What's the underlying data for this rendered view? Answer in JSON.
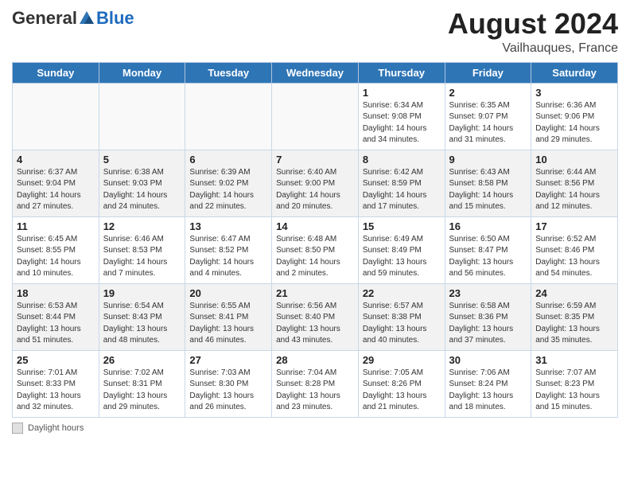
{
  "header": {
    "logo_general": "General",
    "logo_blue": "Blue",
    "title": "August 2024",
    "subtitle": "Vailhauques, France"
  },
  "footer": {
    "legend_label": "Daylight hours"
  },
  "days_of_week": [
    "Sunday",
    "Monday",
    "Tuesday",
    "Wednesday",
    "Thursday",
    "Friday",
    "Saturday"
  ],
  "weeks": [
    [
      {
        "num": "",
        "info": ""
      },
      {
        "num": "",
        "info": ""
      },
      {
        "num": "",
        "info": ""
      },
      {
        "num": "",
        "info": ""
      },
      {
        "num": "1",
        "info": "Sunrise: 6:34 AM\nSunset: 9:08 PM\nDaylight: 14 hours\nand 34 minutes."
      },
      {
        "num": "2",
        "info": "Sunrise: 6:35 AM\nSunset: 9:07 PM\nDaylight: 14 hours\nand 31 minutes."
      },
      {
        "num": "3",
        "info": "Sunrise: 6:36 AM\nSunset: 9:06 PM\nDaylight: 14 hours\nand 29 minutes."
      }
    ],
    [
      {
        "num": "4",
        "info": "Sunrise: 6:37 AM\nSunset: 9:04 PM\nDaylight: 14 hours\nand 27 minutes."
      },
      {
        "num": "5",
        "info": "Sunrise: 6:38 AM\nSunset: 9:03 PM\nDaylight: 14 hours\nand 24 minutes."
      },
      {
        "num": "6",
        "info": "Sunrise: 6:39 AM\nSunset: 9:02 PM\nDaylight: 14 hours\nand 22 minutes."
      },
      {
        "num": "7",
        "info": "Sunrise: 6:40 AM\nSunset: 9:00 PM\nDaylight: 14 hours\nand 20 minutes."
      },
      {
        "num": "8",
        "info": "Sunrise: 6:42 AM\nSunset: 8:59 PM\nDaylight: 14 hours\nand 17 minutes."
      },
      {
        "num": "9",
        "info": "Sunrise: 6:43 AM\nSunset: 8:58 PM\nDaylight: 14 hours\nand 15 minutes."
      },
      {
        "num": "10",
        "info": "Sunrise: 6:44 AM\nSunset: 8:56 PM\nDaylight: 14 hours\nand 12 minutes."
      }
    ],
    [
      {
        "num": "11",
        "info": "Sunrise: 6:45 AM\nSunset: 8:55 PM\nDaylight: 14 hours\nand 10 minutes."
      },
      {
        "num": "12",
        "info": "Sunrise: 6:46 AM\nSunset: 8:53 PM\nDaylight: 14 hours\nand 7 minutes."
      },
      {
        "num": "13",
        "info": "Sunrise: 6:47 AM\nSunset: 8:52 PM\nDaylight: 14 hours\nand 4 minutes."
      },
      {
        "num": "14",
        "info": "Sunrise: 6:48 AM\nSunset: 8:50 PM\nDaylight: 14 hours\nand 2 minutes."
      },
      {
        "num": "15",
        "info": "Sunrise: 6:49 AM\nSunset: 8:49 PM\nDaylight: 13 hours\nand 59 minutes."
      },
      {
        "num": "16",
        "info": "Sunrise: 6:50 AM\nSunset: 8:47 PM\nDaylight: 13 hours\nand 56 minutes."
      },
      {
        "num": "17",
        "info": "Sunrise: 6:52 AM\nSunset: 8:46 PM\nDaylight: 13 hours\nand 54 minutes."
      }
    ],
    [
      {
        "num": "18",
        "info": "Sunrise: 6:53 AM\nSunset: 8:44 PM\nDaylight: 13 hours\nand 51 minutes."
      },
      {
        "num": "19",
        "info": "Sunrise: 6:54 AM\nSunset: 8:43 PM\nDaylight: 13 hours\nand 48 minutes."
      },
      {
        "num": "20",
        "info": "Sunrise: 6:55 AM\nSunset: 8:41 PM\nDaylight: 13 hours\nand 46 minutes."
      },
      {
        "num": "21",
        "info": "Sunrise: 6:56 AM\nSunset: 8:40 PM\nDaylight: 13 hours\nand 43 minutes."
      },
      {
        "num": "22",
        "info": "Sunrise: 6:57 AM\nSunset: 8:38 PM\nDaylight: 13 hours\nand 40 minutes."
      },
      {
        "num": "23",
        "info": "Sunrise: 6:58 AM\nSunset: 8:36 PM\nDaylight: 13 hours\nand 37 minutes."
      },
      {
        "num": "24",
        "info": "Sunrise: 6:59 AM\nSunset: 8:35 PM\nDaylight: 13 hours\nand 35 minutes."
      }
    ],
    [
      {
        "num": "25",
        "info": "Sunrise: 7:01 AM\nSunset: 8:33 PM\nDaylight: 13 hours\nand 32 minutes."
      },
      {
        "num": "26",
        "info": "Sunrise: 7:02 AM\nSunset: 8:31 PM\nDaylight: 13 hours\nand 29 minutes."
      },
      {
        "num": "27",
        "info": "Sunrise: 7:03 AM\nSunset: 8:30 PM\nDaylight: 13 hours\nand 26 minutes."
      },
      {
        "num": "28",
        "info": "Sunrise: 7:04 AM\nSunset: 8:28 PM\nDaylight: 13 hours\nand 23 minutes."
      },
      {
        "num": "29",
        "info": "Sunrise: 7:05 AM\nSunset: 8:26 PM\nDaylight: 13 hours\nand 21 minutes."
      },
      {
        "num": "30",
        "info": "Sunrise: 7:06 AM\nSunset: 8:24 PM\nDaylight: 13 hours\nand 18 minutes."
      },
      {
        "num": "31",
        "info": "Sunrise: 7:07 AM\nSunset: 8:23 PM\nDaylight: 13 hours\nand 15 minutes."
      }
    ]
  ]
}
